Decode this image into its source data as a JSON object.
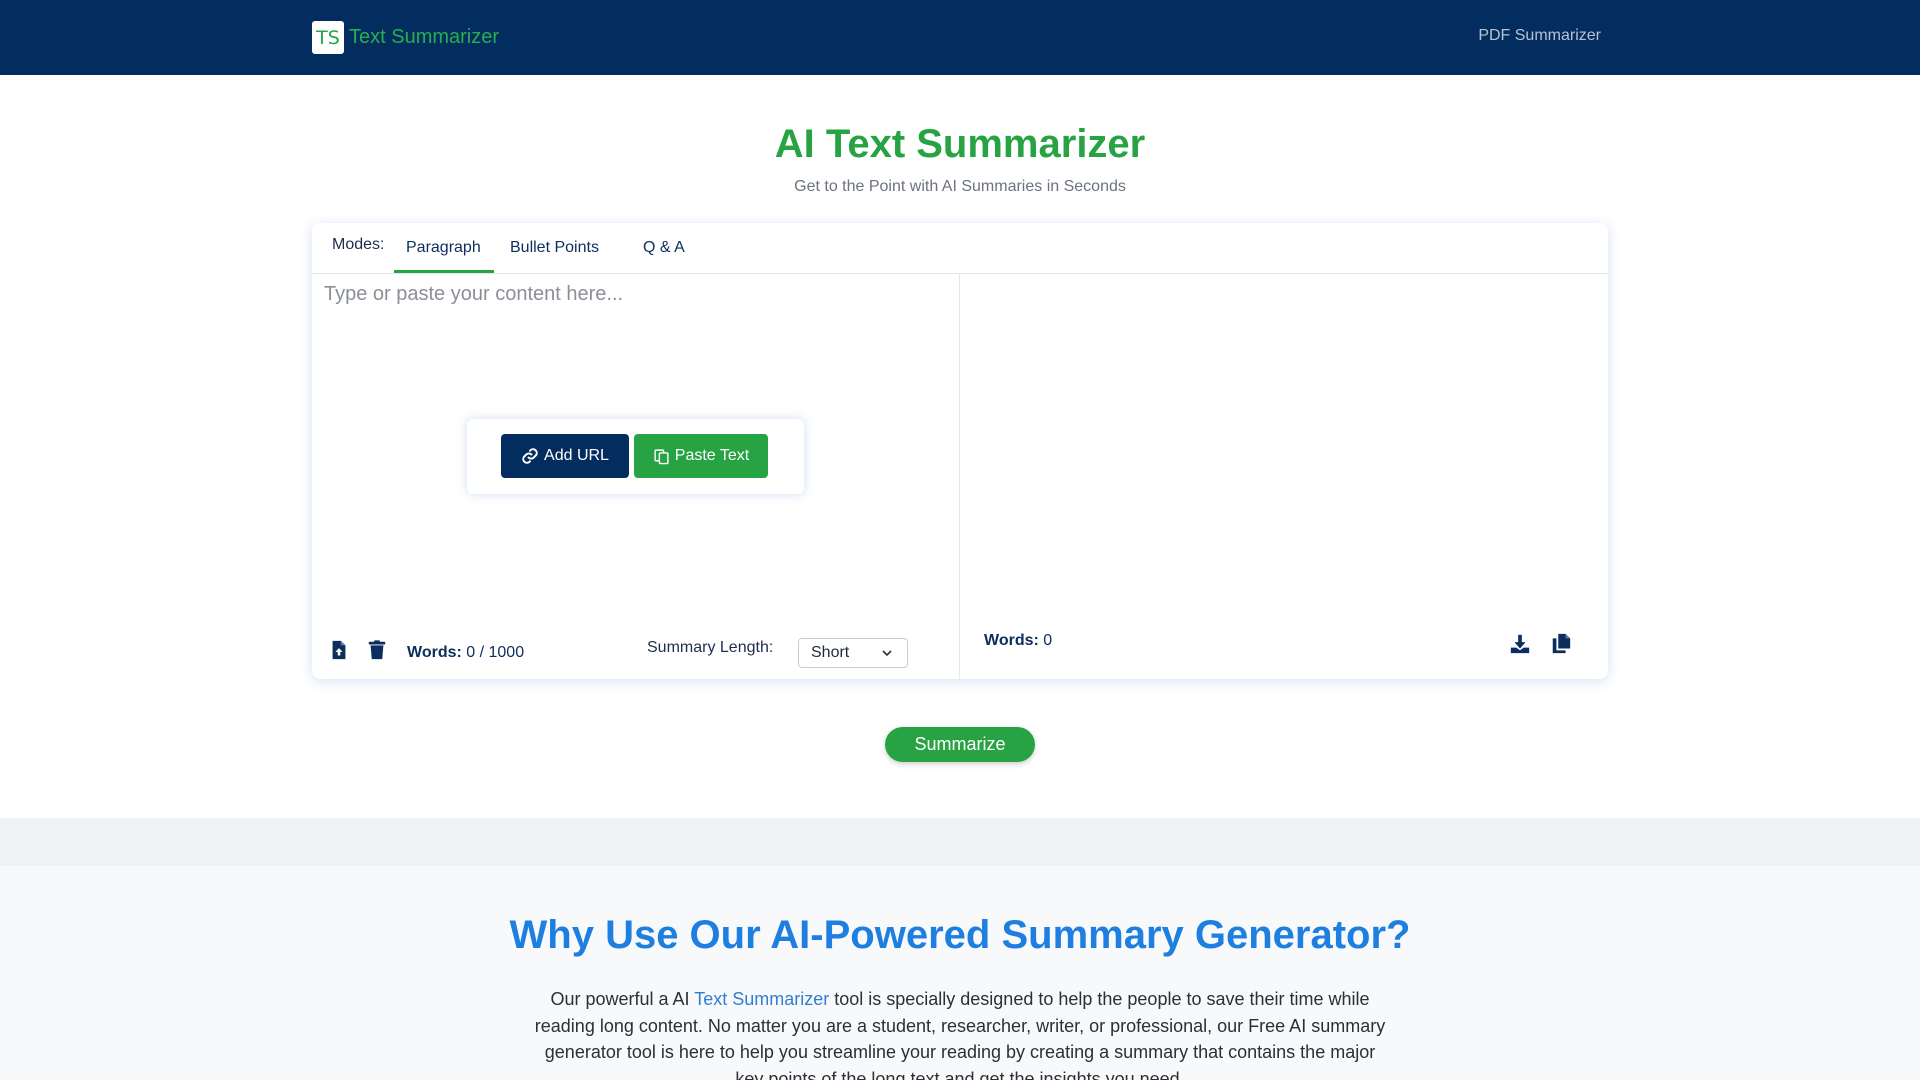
{
  "navbar": {
    "logo_text": "TS",
    "brand_name": "Text Summarizer",
    "link_pdf": "PDF Summarizer"
  },
  "hero": {
    "title": "AI Text Summarizer",
    "subtitle": "Get to the Point with AI Summaries in Seconds"
  },
  "modes": {
    "label": "Modes:",
    "tabs": [
      {
        "label": "Paragraph",
        "active": true
      },
      {
        "label": "Bullet Points",
        "active": false
      },
      {
        "label": "Q & A",
        "active": false
      }
    ]
  },
  "input": {
    "placeholder": "Type or paste your content here...",
    "add_url_label": "Add URL",
    "paste_text_label": "Paste Text",
    "words_label": "Words:",
    "words_value": "0 / 1000",
    "summary_length_label": "Summary Length:",
    "summary_length_value": "Short",
    "icons": [
      "file-upload-icon",
      "trash-icon",
      "link-icon",
      "paste-icon"
    ]
  },
  "output": {
    "words_label": "Words:",
    "words_value": "0",
    "icons": [
      "download-icon",
      "copy-icon"
    ]
  },
  "summarize_label": "Summarize",
  "why": {
    "title": "Why Use Our AI-Powered Summary Generator?",
    "text_before": "Our powerful a AI ",
    "link_text": "Text Summarizer",
    "text_after": " tool is specially designed to help the people to save their time while reading long content. No matter you are a student, researcher, writer, or professional, our Free AI summary generator tool is here to help you streamline your reading by creating a summary that contains the major key points of the long text and get the insights you need."
  },
  "colors": {
    "navbar_bg": "#032d5e",
    "brand_green": "#27a344",
    "heading_blue": "#1e7fe0",
    "link_blue": "#2e7fd6"
  }
}
